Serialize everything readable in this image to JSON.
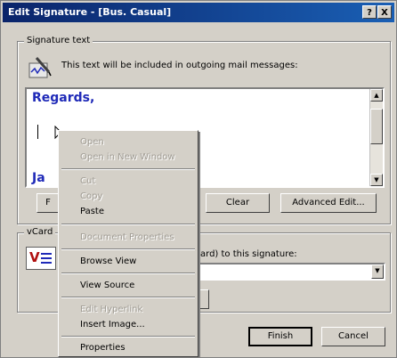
{
  "window": {
    "title": "Edit Signature - [Bus. Casual]",
    "help_label": "?",
    "close_label": "X"
  },
  "signature_group": {
    "label": "Signature text",
    "info": "This text will be included in outgoing mail messages:",
    "editor_line1": "Regards,",
    "editor_line3": "Ja"
  },
  "signature_buttons": {
    "left_partial": "F",
    "clear": "Clear",
    "advanced_edit": "Advanced Edit..."
  },
  "vcard_group": {
    "label": "vCard",
    "attach_text": "ard) to this signature:",
    "icon_letters": "V"
  },
  "footer": {
    "finish": "Finish",
    "cancel": "Cancel"
  },
  "context_menu": {
    "items": [
      {
        "label": "Open",
        "disabled": true
      },
      {
        "label": "Open in New Window",
        "disabled": true
      },
      {
        "label": "Cut",
        "disabled": true
      },
      {
        "label": "Copy",
        "disabled": true
      },
      {
        "label": "Paste",
        "disabled": false
      },
      {
        "label": "Document Properties",
        "disabled": true
      },
      {
        "label": "Browse View",
        "disabled": false
      },
      {
        "label": "View Source",
        "disabled": false
      },
      {
        "label": "Edit Hyperlink",
        "disabled": true
      },
      {
        "label": "Insert Image...",
        "disabled": false
      },
      {
        "label": "Properties",
        "disabled": false
      }
    ]
  },
  "colors": {
    "title_bar": "#0a246a",
    "dialog_bg": "#d4d0c8",
    "editor_text": "#1f2ab8",
    "disabled_text": "#a09c94"
  },
  "icons": [
    "signature-pen-icon",
    "vcard-icon",
    "mouse-cursor-icon"
  ]
}
